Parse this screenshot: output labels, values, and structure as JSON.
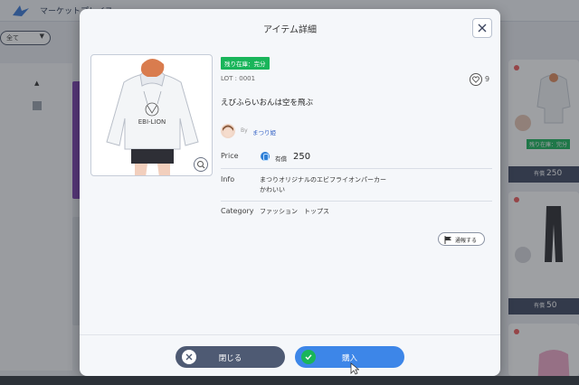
{
  "background": {
    "app_title": "マーケットプレイス",
    "filter_value": "全て",
    "cards": [
      {
        "badge": "残り在庫：完分",
        "currency": "有償",
        "price": "250"
      },
      {
        "badge": "",
        "currency": "有償",
        "price": "50"
      },
      {
        "badge": "",
        "currency": "",
        "price": ""
      }
    ]
  },
  "modal": {
    "title": "アイテム詳細",
    "stock_badge": "残り在庫：完分",
    "lot": "LOT : 0001",
    "like_count": "9",
    "item_name": "えびふらいおんは空を飛ぶ",
    "seller_prefix": "By",
    "seller_name": "まつり姫",
    "price_label": "Price",
    "price_unit": "有償",
    "price_value": "250",
    "info_label": "Info",
    "info_lines": [
      "まつりオリジナルのエビフライオンパーカー",
      "かわいい"
    ],
    "category_label": "Category",
    "categories": [
      "ファッション",
      "トップス"
    ],
    "report_label": "通報する",
    "close_button": "閉じる",
    "buy_button": "購入",
    "hoodie_text": "EBI-LION"
  },
  "colors": {
    "stock_green": "#19b55a",
    "buy_blue": "#3d86e8",
    "close_gray": "#4e5a73"
  },
  "icons": [
    "close-icon",
    "zoom-icon",
    "heart-icon",
    "flag-icon",
    "check-icon",
    "x-circle-icon",
    "coin-icon"
  ]
}
